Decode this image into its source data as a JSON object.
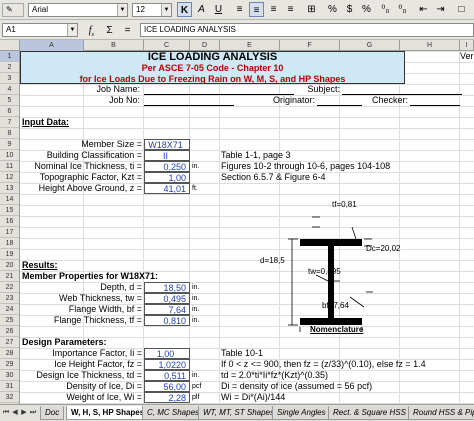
{
  "toolbar": {
    "font_name": "Arial",
    "font_size": "12",
    "buttons": [
      {
        "label": "K",
        "icon": "bold-icon"
      },
      {
        "label": "A",
        "icon": "italic-icon"
      },
      {
        "label": "U",
        "icon": "underline-icon"
      },
      {
        "label": "≡",
        "icon": "align-left-icon"
      },
      {
        "label": "≡",
        "icon": "align-center-icon"
      },
      {
        "label": "≡",
        "icon": "align-right-icon"
      },
      {
        "label": "≡",
        "icon": "justify-icon"
      },
      {
        "label": "⊞",
        "icon": "merge-cells-icon"
      },
      {
        "label": "%",
        "icon": "percent-icon"
      },
      {
        "label": "$",
        "icon": "currency-icon"
      },
      {
        "label": "%",
        "icon": "decimal-icon"
      },
      {
        "label": "⁰₀",
        "icon": "add-decimal-icon"
      },
      {
        "label": "⁰₀",
        "icon": "remove-decimal-icon"
      },
      {
        "label": "⇤",
        "icon": "decrease-indent-icon"
      },
      {
        "label": "⇥",
        "icon": "increase-indent-icon"
      },
      {
        "label": "□",
        "icon": "borders-icon"
      }
    ]
  },
  "formula_bar": {
    "cell_ref": "A1",
    "fx": "f",
    "sum": "Σ",
    "equals": "=",
    "content": "ICE LOADING ANALYSIS"
  },
  "columns": [
    "A",
    "B",
    "C",
    "D",
    "E",
    "F",
    "G",
    "H",
    "I"
  ],
  "selected_column": "A",
  "rows": [
    "1",
    "2",
    "3",
    "4",
    "5",
    "6",
    "7",
    "8",
    "9",
    "10",
    "11",
    "12",
    "13",
    "14",
    "15",
    "16",
    "17",
    "18",
    "19",
    "20",
    "21",
    "22",
    "23",
    "24",
    "25",
    "26",
    "27",
    "28",
    "29",
    "30",
    "31",
    "32"
  ],
  "selected_row": "1",
  "sheet": {
    "title": "ICE LOADING ANALYSIS",
    "subtitle1": "Per ASCE 7-05 Code - Chapter 10",
    "subtitle2": "for Ice Loads Due to Freezing Rain on W, M, S, and HP Shapes",
    "right_edge": "Ver",
    "job_name": "Job Name:",
    "job_no": "Job No:",
    "subject": "Subject:",
    "originator": "Originator:",
    "checker": "Checker:",
    "input_data": "Input Data:",
    "inputs": [
      {
        "label": "Member Size =",
        "value": "W18X71",
        "unit": "",
        "note": ""
      },
      {
        "label": "Building Classification =",
        "value": "II",
        "unit": "",
        "note": "Table 1-1, page 3"
      },
      {
        "label": "Nominal Ice Thickness, ti =",
        "value": "0,250",
        "unit": "in.",
        "note": "Figures 10-2 through 10-6, pages 104-108"
      },
      {
        "label": "Topographic Factor, Kzt =",
        "value": "1,00",
        "unit": "",
        "note": "Section 6.5.7 & Figure 6-4"
      },
      {
        "label": "Height Above Ground, z =",
        "value": "41,01",
        "unit": "ft.",
        "note": ""
      }
    ],
    "results": "Results:",
    "member_props_title": "Member Properties for W18X71:",
    "member_props": [
      {
        "label": "Depth, d =",
        "value": "18,50",
        "unit": "in."
      },
      {
        "label": "Web Thickness, tw =",
        "value": "0,495",
        "unit": "in."
      },
      {
        "label": "Flange Width, bf =",
        "value": "7,64",
        "unit": "in."
      },
      {
        "label": "Flange Thickness, tf =",
        "value": "0,810",
        "unit": "in."
      }
    ],
    "design_params": "Design Parameters:",
    "design": [
      {
        "label": "Importance Factor, Ii =",
        "value": "1,00",
        "unit": "",
        "note": "Table 10-1"
      },
      {
        "label": "Ice Height Factor, fz =",
        "value": "1,0220",
        "unit": "",
        "note": "If  0 < z <= 900,  then fz = (z/33)^(0.10),  else fz = 1.4"
      },
      {
        "label": "Design Ice Thickness, td =",
        "value": "0,511",
        "unit": "in.",
        "note": "td = 2.0*ti*Ii*fz*(Kzt)^(0.35)"
      },
      {
        "label": "Density of Ice, Di =",
        "value": "56,00",
        "unit": "pcf",
        "note": "Di = density of ice (assumed = 56 pcf)"
      },
      {
        "label": "Weight of Ice, Wi =",
        "value": "2,28",
        "unit": "plf",
        "note": "Wi = Di*(Ai)/144"
      }
    ],
    "diagram": {
      "tf": "tf=0,81",
      "d": "d=18,5",
      "tw": "tw=0,495",
      "dc": "Dc=20,02",
      "bf": "bf=7,64",
      "caption": "Nomenclature"
    }
  },
  "tabs": [
    "Doc",
    "W, H, S, HP Shapes",
    "C, MC Shapes",
    "WT, MT, ST Shapes",
    "Single Angles",
    "Rect. & Square HSS",
    "Round HSS & Pipes"
  ],
  "active_tab": "W, H, S, HP Shapes",
  "colors": {
    "banner": "#cfe8f5",
    "title_red": "#c00000",
    "input_blue": "#1f3fbf",
    "input_bg": "#ffff99"
  }
}
